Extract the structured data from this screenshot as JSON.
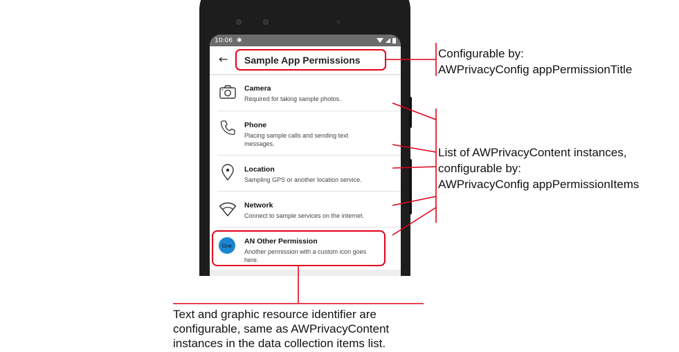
{
  "statusbar": {
    "time": "10:06"
  },
  "appbar": {
    "back_glyph": "←",
    "title": "Sample App Permissions"
  },
  "items": [
    {
      "icon": "camera-icon",
      "title": "Camera",
      "desc": "Required for taking sample photos."
    },
    {
      "icon": "phone-icon",
      "title": "Phone",
      "desc": "Placing sample calls and sending text messages."
    },
    {
      "icon": "location-icon",
      "title": "Location",
      "desc": "Sampling GPS or another location service."
    },
    {
      "icon": "wifi-icon",
      "title": "Network",
      "desc": "Connect to sample services on the internet."
    },
    {
      "icon": "custom-one-icon",
      "badge": "One",
      "title": "AN Other Permission",
      "desc": "Another permission with a custom icon goes here."
    }
  ],
  "annotations": {
    "title_note": {
      "line1": "Configurable by:",
      "line2": "AWPrivacyConfig appPermissionTitle"
    },
    "items_note": {
      "line1": "List of AWPrivacyContent instances,",
      "line2": "configurable by:",
      "line3": "AWPrivacyConfig appPermissionItems"
    },
    "custom_note": {
      "line1": "Text and graphic resource identifier are",
      "line2": "configurable, same as AWPrivacyContent",
      "line3": "instances in the data collection items list."
    }
  },
  "colors": {
    "annotation_red": "#e3001b",
    "badge_blue": "#1a86d0",
    "status_gray": "#6c6c6c"
  }
}
